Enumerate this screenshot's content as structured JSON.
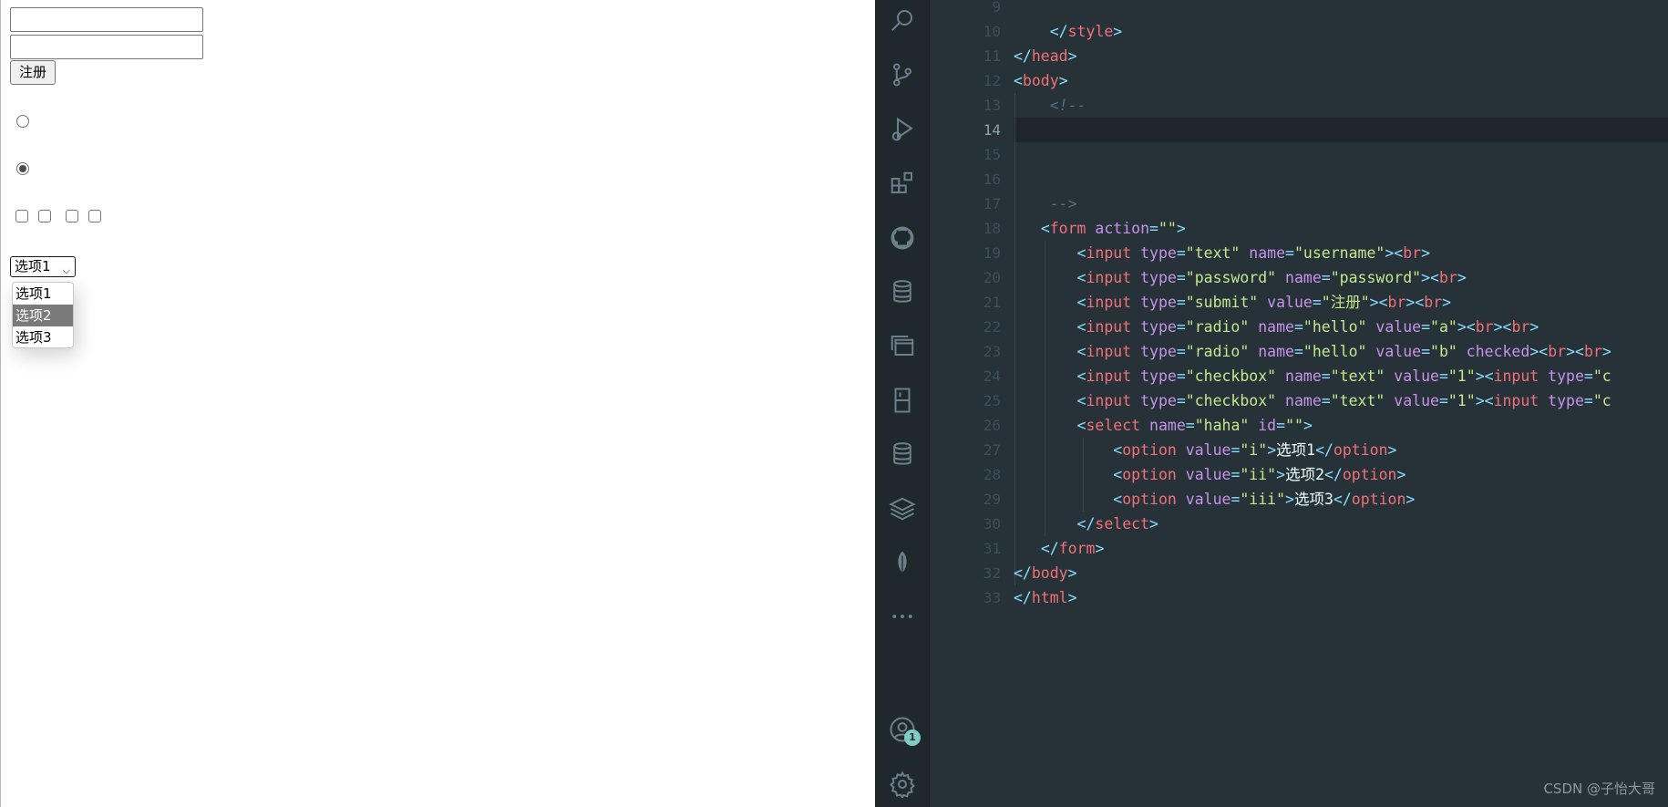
{
  "preview": {
    "submit_label": "注册",
    "select_value": "选项1",
    "select_options": [
      "选项1",
      "选项2",
      "选项3"
    ],
    "highlighted_option": "选项2"
  },
  "editor": {
    "line_numbers": [
      "9",
      "10",
      "11",
      "12",
      "13",
      "14",
      "15",
      "16",
      "17",
      "18",
      "19",
      "20",
      "21",
      "22",
      "23",
      "24",
      "25",
      "26",
      "27",
      "28",
      "29",
      "30",
      "31",
      "32",
      "33"
    ],
    "active_line": "14",
    "lines": [
      [],
      [
        [
          "    ",
          "t-txt"
        ],
        [
          "</",
          "t-pun"
        ],
        [
          "style",
          "t-tag"
        ],
        [
          ">",
          "t-pun"
        ]
      ],
      [
        [
          "</",
          "t-pun"
        ],
        [
          "head",
          "t-tag"
        ],
        [
          ">",
          "t-pun"
        ]
      ],
      [
        [
          "<",
          "t-pun"
        ],
        [
          "body",
          "t-tag"
        ],
        [
          ">",
          "t-pun"
        ]
      ],
      [
        [
          "    ",
          "t-txt"
        ],
        [
          "<!--",
          "t-com"
        ]
      ],
      [],
      [],
      [],
      [
        [
          "    ",
          "t-txt"
        ],
        [
          "-->",
          "t-com"
        ]
      ],
      [
        [
          "   ",
          "t-txt"
        ],
        [
          "<",
          "t-pun"
        ],
        [
          "form",
          "t-tag"
        ],
        [
          " action",
          "t-attr"
        ],
        [
          "=",
          "t-eq"
        ],
        [
          "\"\"",
          "t-str"
        ],
        [
          ">",
          "t-pun"
        ]
      ],
      [
        [
          "       ",
          "t-txt"
        ],
        [
          "<",
          "t-pun"
        ],
        [
          "input",
          "t-tag"
        ],
        [
          " type",
          "t-attr"
        ],
        [
          "=",
          "t-eq"
        ],
        [
          "\"text\"",
          "t-str"
        ],
        [
          " name",
          "t-attr"
        ],
        [
          "=",
          "t-eq"
        ],
        [
          "\"username\"",
          "t-str"
        ],
        [
          ">",
          "t-pun"
        ],
        [
          "<",
          "t-pun"
        ],
        [
          "br",
          "t-tag"
        ],
        [
          ">",
          "t-pun"
        ]
      ],
      [
        [
          "       ",
          "t-txt"
        ],
        [
          "<",
          "t-pun"
        ],
        [
          "input",
          "t-tag"
        ],
        [
          " type",
          "t-attr"
        ],
        [
          "=",
          "t-eq"
        ],
        [
          "\"password\"",
          "t-str"
        ],
        [
          " name",
          "t-attr"
        ],
        [
          "=",
          "t-eq"
        ],
        [
          "\"password\"",
          "t-str"
        ],
        [
          ">",
          "t-pun"
        ],
        [
          "<",
          "t-pun"
        ],
        [
          "br",
          "t-tag"
        ],
        [
          ">",
          "t-pun"
        ]
      ],
      [
        [
          "       ",
          "t-txt"
        ],
        [
          "<",
          "t-pun"
        ],
        [
          "input",
          "t-tag"
        ],
        [
          " type",
          "t-attr"
        ],
        [
          "=",
          "t-eq"
        ],
        [
          "\"submit\"",
          "t-str"
        ],
        [
          " value",
          "t-attr"
        ],
        [
          "=",
          "t-eq"
        ],
        [
          "\"注册\"",
          "t-str"
        ],
        [
          ">",
          "t-pun"
        ],
        [
          "<",
          "t-pun"
        ],
        [
          "br",
          "t-tag"
        ],
        [
          ">",
          "t-pun"
        ],
        [
          "<",
          "t-pun"
        ],
        [
          "br",
          "t-tag"
        ],
        [
          ">",
          "t-pun"
        ]
      ],
      [
        [
          "       ",
          "t-txt"
        ],
        [
          "<",
          "t-pun"
        ],
        [
          "input",
          "t-tag"
        ],
        [
          " type",
          "t-attr"
        ],
        [
          "=",
          "t-eq"
        ],
        [
          "\"radio\"",
          "t-str"
        ],
        [
          " name",
          "t-attr"
        ],
        [
          "=",
          "t-eq"
        ],
        [
          "\"hello\"",
          "t-str"
        ],
        [
          " value",
          "t-attr"
        ],
        [
          "=",
          "t-eq"
        ],
        [
          "\"a\"",
          "t-str"
        ],
        [
          ">",
          "t-pun"
        ],
        [
          "<",
          "t-pun"
        ],
        [
          "br",
          "t-tag"
        ],
        [
          ">",
          "t-pun"
        ],
        [
          "<",
          "t-pun"
        ],
        [
          "br",
          "t-tag"
        ],
        [
          ">",
          "t-pun"
        ]
      ],
      [
        [
          "       ",
          "t-txt"
        ],
        [
          "<",
          "t-pun"
        ],
        [
          "input",
          "t-tag"
        ],
        [
          " type",
          "t-attr"
        ],
        [
          "=",
          "t-eq"
        ],
        [
          "\"radio\"",
          "t-str"
        ],
        [
          " name",
          "t-attr"
        ],
        [
          "=",
          "t-eq"
        ],
        [
          "\"hello\"",
          "t-str"
        ],
        [
          " value",
          "t-attr"
        ],
        [
          "=",
          "t-eq"
        ],
        [
          "\"b\"",
          "t-str"
        ],
        [
          " checked",
          "t-attr"
        ],
        [
          ">",
          "t-pun"
        ],
        [
          "<",
          "t-pun"
        ],
        [
          "br",
          "t-tag"
        ],
        [
          ">",
          "t-pun"
        ],
        [
          "<",
          "t-pun"
        ],
        [
          "br",
          "t-tag"
        ],
        [
          ">",
          "t-pun"
        ]
      ],
      [
        [
          "       ",
          "t-txt"
        ],
        [
          "<",
          "t-pun"
        ],
        [
          "input",
          "t-tag"
        ],
        [
          " type",
          "t-attr"
        ],
        [
          "=",
          "t-eq"
        ],
        [
          "\"checkbox\"",
          "t-str"
        ],
        [
          " name",
          "t-attr"
        ],
        [
          "=",
          "t-eq"
        ],
        [
          "\"text\"",
          "t-str"
        ],
        [
          " value",
          "t-attr"
        ],
        [
          "=",
          "t-eq"
        ],
        [
          "\"1\"",
          "t-str"
        ],
        [
          ">",
          "t-pun"
        ],
        [
          "<",
          "t-pun"
        ],
        [
          "input",
          "t-tag"
        ],
        [
          " type",
          "t-attr"
        ],
        [
          "=",
          "t-eq"
        ],
        [
          "\"c",
          "t-str"
        ]
      ],
      [
        [
          "       ",
          "t-txt"
        ],
        [
          "<",
          "t-pun"
        ],
        [
          "input",
          "t-tag"
        ],
        [
          " type",
          "t-attr"
        ],
        [
          "=",
          "t-eq"
        ],
        [
          "\"checkbox\"",
          "t-str"
        ],
        [
          " name",
          "t-attr"
        ],
        [
          "=",
          "t-eq"
        ],
        [
          "\"text\"",
          "t-str"
        ],
        [
          " value",
          "t-attr"
        ],
        [
          "=",
          "t-eq"
        ],
        [
          "\"1\"",
          "t-str"
        ],
        [
          ">",
          "t-pun"
        ],
        [
          "<",
          "t-pun"
        ],
        [
          "input",
          "t-tag"
        ],
        [
          " type",
          "t-attr"
        ],
        [
          "=",
          "t-eq"
        ],
        [
          "\"c",
          "t-str"
        ]
      ],
      [
        [
          "       ",
          "t-txt"
        ],
        [
          "<",
          "t-pun"
        ],
        [
          "select",
          "t-tag"
        ],
        [
          " name",
          "t-attr"
        ],
        [
          "=",
          "t-eq"
        ],
        [
          "\"haha\"",
          "t-str"
        ],
        [
          " id",
          "t-attr"
        ],
        [
          "=",
          "t-eq"
        ],
        [
          "\"\"",
          "t-str"
        ],
        [
          ">",
          "t-pun"
        ]
      ],
      [
        [
          "           ",
          "t-txt"
        ],
        [
          "<",
          "t-pun"
        ],
        [
          "option",
          "t-tag"
        ],
        [
          " value",
          "t-attr"
        ],
        [
          "=",
          "t-eq"
        ],
        [
          "\"i\"",
          "t-str"
        ],
        [
          ">",
          "t-pun"
        ],
        [
          "选项1",
          "t-txt"
        ],
        [
          "</",
          "t-pun"
        ],
        [
          "option",
          "t-tag"
        ],
        [
          ">",
          "t-pun"
        ]
      ],
      [
        [
          "           ",
          "t-txt"
        ],
        [
          "<",
          "t-pun"
        ],
        [
          "option",
          "t-tag"
        ],
        [
          " value",
          "t-attr"
        ],
        [
          "=",
          "t-eq"
        ],
        [
          "\"ii\"",
          "t-str"
        ],
        [
          ">",
          "t-pun"
        ],
        [
          "选项2",
          "t-txt"
        ],
        [
          "</",
          "t-pun"
        ],
        [
          "option",
          "t-tag"
        ],
        [
          ">",
          "t-pun"
        ]
      ],
      [
        [
          "           ",
          "t-txt"
        ],
        [
          "<",
          "t-pun"
        ],
        [
          "option",
          "t-tag"
        ],
        [
          " value",
          "t-attr"
        ],
        [
          "=",
          "t-eq"
        ],
        [
          "\"iii\"",
          "t-str"
        ],
        [
          ">",
          "t-pun"
        ],
        [
          "选项3",
          "t-txt"
        ],
        [
          "</",
          "t-pun"
        ],
        [
          "option",
          "t-tag"
        ],
        [
          ">",
          "t-pun"
        ]
      ],
      [
        [
          "       ",
          "t-txt"
        ],
        [
          "</",
          "t-pun"
        ],
        [
          "select",
          "t-tag"
        ],
        [
          ">",
          "t-pun"
        ]
      ],
      [
        [
          "   ",
          "t-txt"
        ],
        [
          "</",
          "t-pun"
        ],
        [
          "form",
          "t-tag"
        ],
        [
          ">",
          "t-pun"
        ]
      ],
      [
        [
          "</",
          "t-pun"
        ],
        [
          "body",
          "t-tag"
        ],
        [
          ">",
          "t-pun"
        ]
      ],
      [
        [
          "</",
          "t-pun"
        ],
        [
          "html",
          "t-tag"
        ],
        [
          ">",
          "t-pun"
        ]
      ]
    ],
    "activity_icons": [
      "search-icon",
      "source-control-icon",
      "run-debug-icon",
      "extensions-icon",
      "github-icon",
      "database-icon",
      "remote-explorer-icon",
      "bookmark-icon",
      "database-icon",
      "layers-icon",
      "mongodb-leaf-icon",
      "more-icon",
      "account-icon",
      "settings-gear-icon"
    ],
    "account_badge": "1"
  },
  "watermark": "CSDN @子怡大哥"
}
